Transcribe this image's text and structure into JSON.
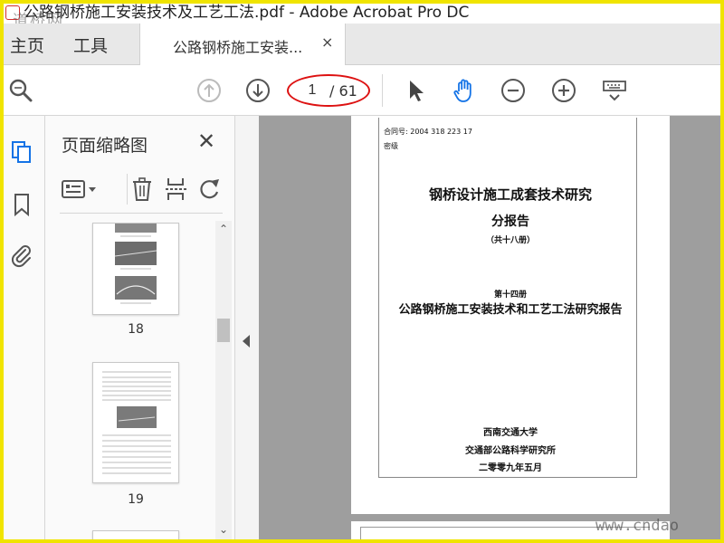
{
  "window": {
    "title": "公路钢桥施工安装技术及工艺工法.pdf - Adobe Acrobat Pro DC",
    "watermark_top": "道桥网"
  },
  "tabs": {
    "home_label": "主页",
    "tools_label": "工具",
    "doc_tab_label": "公路钢桥施工安装...",
    "close_glyph": "×"
  },
  "toolbar": {
    "current_page": "1",
    "total_pages": "/ 61",
    "icons": [
      "search-icon",
      "page-up-icon",
      "page-down-icon",
      "select-arrow-icon",
      "hand-icon",
      "zoom-out-icon",
      "zoom-in-icon",
      "keyboard-icon"
    ]
  },
  "left_strip": {
    "icons": [
      "page-thumbnails-icon",
      "bookmark-icon",
      "attachment-icon"
    ]
  },
  "thumbnails_panel": {
    "title": "页面缩略图",
    "close_glyph": "✕",
    "tools": [
      "thumb-options-icon",
      "delete-icon",
      "extract-icon",
      "rotate-icon"
    ],
    "pages": [
      {
        "number": "18"
      },
      {
        "number": "19"
      }
    ]
  },
  "document": {
    "contract_line": "合同号:  2004  318  223  17",
    "secret_line": "密级",
    "title_line1": "钢桥设计施工成套技术研究",
    "title_line2": "分报告",
    "volumes_note": "（共十八册）",
    "volume_label": "第十四册",
    "report_title": "公路钢桥施工安装技术和工艺工法研究报告",
    "org1": "西南交通大学",
    "org2": "交通部公路科学研究所",
    "date": "二零零九年五月"
  },
  "watermark_bottom": "www.cndao"
}
